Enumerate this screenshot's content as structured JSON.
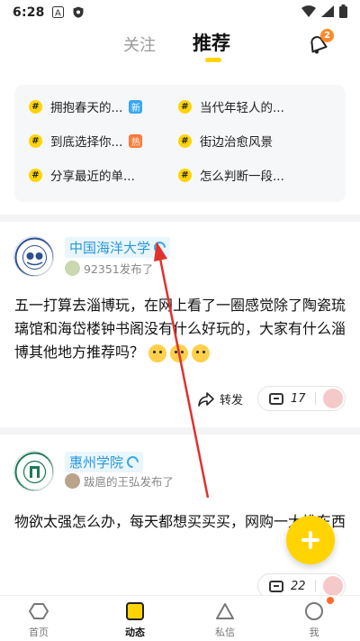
{
  "status_bar": {
    "time": "6:28",
    "icons": [
      "a-icon",
      "shield-icon",
      "wifi-icon",
      "signal-icon",
      "battery-icon"
    ]
  },
  "top_nav": {
    "tabs": [
      "关注",
      "推荐"
    ],
    "active_tab": "推荐",
    "bell_badge": "2"
  },
  "topics": [
    {
      "label": "拥抱春天的...",
      "tag": "新"
    },
    {
      "label": "当代年轻人的...",
      "tag": ""
    },
    {
      "label": "到底选择你...",
      "tag": "热"
    },
    {
      "label": "街边治愈风景",
      "tag": ""
    },
    {
      "label": "分享最近的单...",
      "tag": ""
    },
    {
      "label": "怎么判断一段...",
      "tag": ""
    }
  ],
  "posts": [
    {
      "school": "中国海洋大学",
      "user": "92351发布了",
      "text": "五一打算去淄博玩，在网上看了一圈感觉除了陶瓷琉璃馆和海岱楼钟书阁没有什么好玩的，大家有什么淄博其他地方推荐吗？",
      "share_label": "转发",
      "comments": "17"
    },
    {
      "school": "惠州学院",
      "user": "跋扈的王弘发布了",
      "text": "物欲太强怎么办，每天都想买买买，网购一大堆东西",
      "comments": "22"
    }
  ],
  "bottom_nav": [
    {
      "label": "首页",
      "icon": "hexagon-icon"
    },
    {
      "label": "动态",
      "icon": "square-icon"
    },
    {
      "label": "私信",
      "icon": "triangle-icon"
    },
    {
      "label": "我",
      "icon": "circle-icon"
    }
  ],
  "colors": {
    "accent": "#ffd400",
    "school": "#2a98d8",
    "arrow": "#e0322d"
  }
}
